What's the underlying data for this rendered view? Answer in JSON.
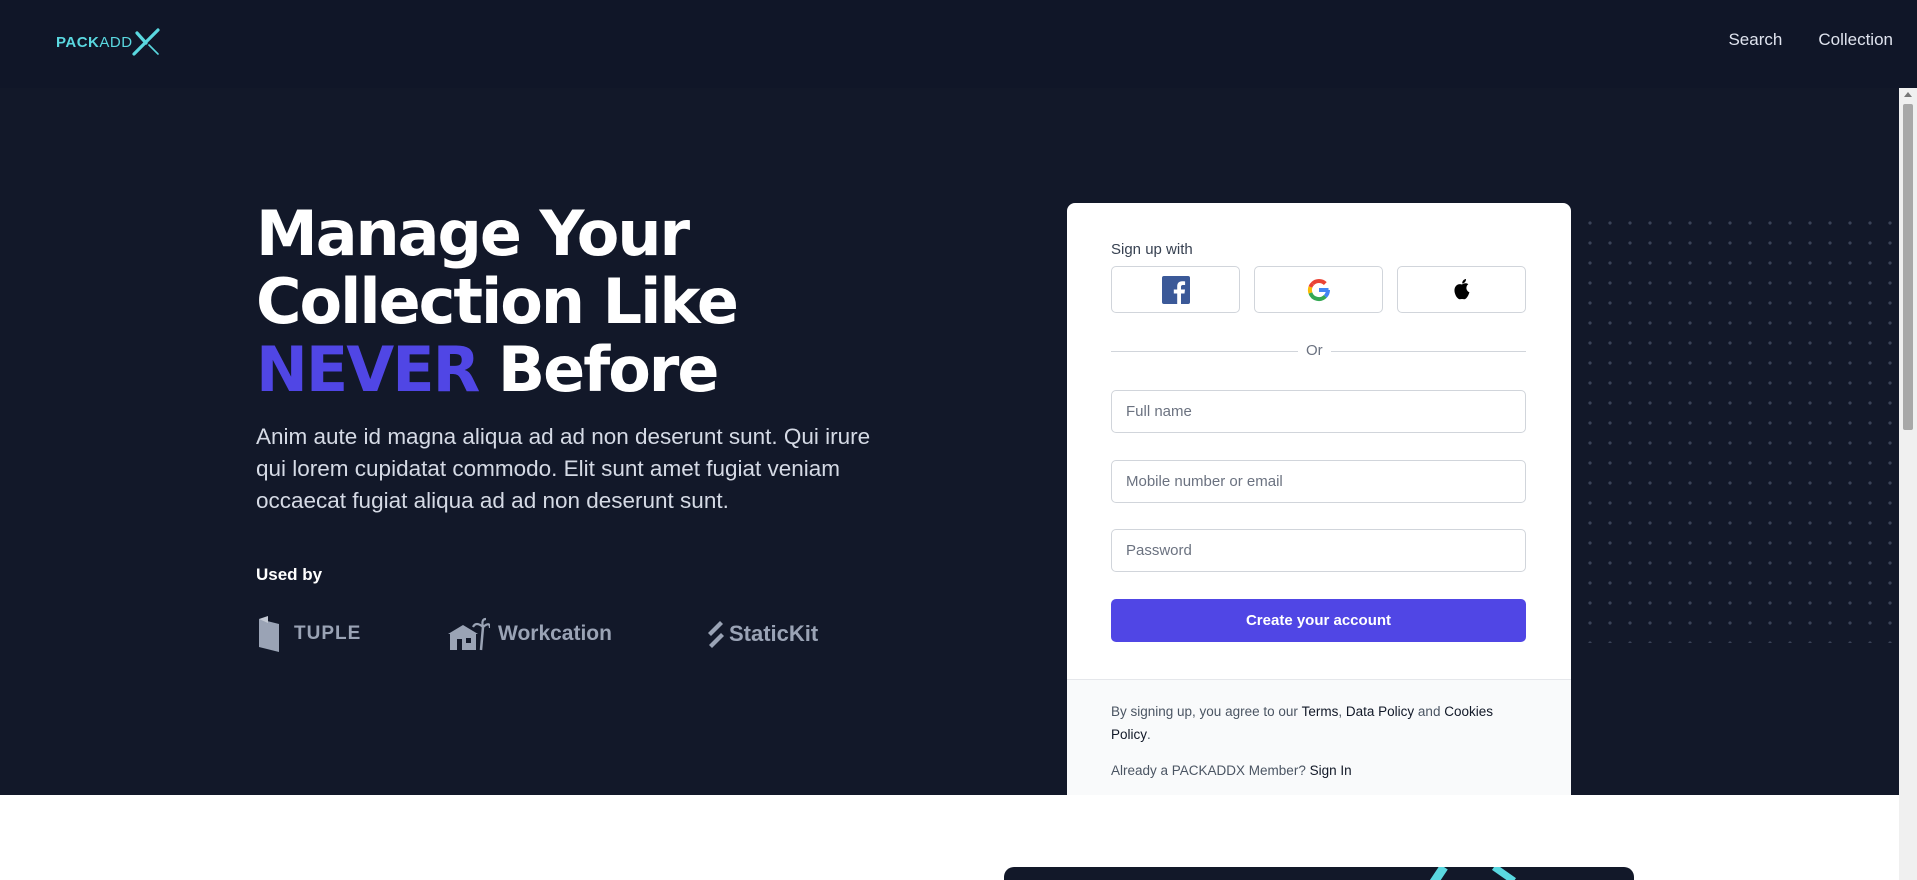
{
  "header": {
    "logo": {
      "part1": "PACK",
      "part2": "ADD",
      "mark": "X"
    },
    "nav": [
      "Search",
      "Collection"
    ]
  },
  "hero": {
    "headline_line1": "Manage Your",
    "headline_line2": "Collection Like",
    "headline_accent": "NEVER",
    "headline_end": "Before",
    "lede": "Anim aute id magna aliqua ad ad non deserunt sunt. Qui irure qui lorem cupidatat commodo. Elit sunt amet fugiat veniam occaecat fugiat aliqua ad ad non deserunt sunt.",
    "used_by": "Used by",
    "brands": [
      "TUPLE",
      "Workcation",
      "StaticKit"
    ]
  },
  "signup_card": {
    "signup_with": "Sign up with",
    "social": [
      "facebook-icon",
      "google-icon",
      "apple-icon"
    ],
    "or": "Or",
    "fields": {
      "full_name": {
        "placeholder": "Full name",
        "value": ""
      },
      "contact": {
        "placeholder": "Mobile number or email",
        "value": ""
      },
      "password": {
        "placeholder": "Password",
        "value": ""
      }
    },
    "submit": "Create your account",
    "terms": {
      "prefix": "By signing up, you agree to our ",
      "terms": "Terms",
      "sep": ", ",
      "data_policy": "Data Policy",
      "and": " and ",
      "cookies": "Cookies Policy",
      "end": "."
    },
    "member_prompt": "Already a PACKADDX Member? ",
    "sign_in": "Sign In"
  },
  "colors": {
    "accent": "#5046e5",
    "background": "#121829",
    "logo": "#5ad8e0"
  }
}
